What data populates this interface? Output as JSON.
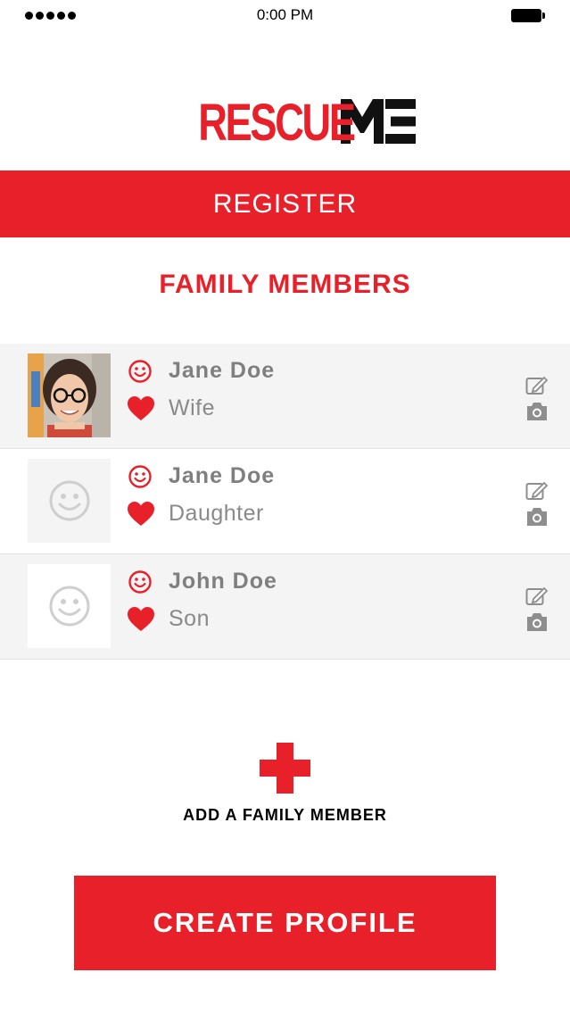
{
  "status_bar": {
    "time": "0:00 PM"
  },
  "logo": {
    "part1": "RESCUE",
    "part2": "ME"
  },
  "header": {
    "title": "REGISTER"
  },
  "section": {
    "title": "FAMILY MEMBERS"
  },
  "members": [
    {
      "name": "Jane Doe",
      "relation": "Wife",
      "has_photo": true
    },
    {
      "name": "Jane Doe",
      "relation": "Daughter",
      "has_photo": false
    },
    {
      "name": "John Doe",
      "relation": "Son",
      "has_photo": false
    }
  ],
  "add_member": {
    "label": "ADD A FAMILY MEMBER"
  },
  "create_profile": {
    "label": "CREATE PROFILE"
  },
  "colors": {
    "brand_red": "#e8202a",
    "row_grey": "#f4f4f4",
    "text_grey": "#7f7f7f",
    "icon_grey": "#8e8e8e"
  },
  "icons": [
    "smiley-icon",
    "heart-icon",
    "edit-icon",
    "camera-icon",
    "plus-icon",
    "avatar-placeholder-icon"
  ]
}
